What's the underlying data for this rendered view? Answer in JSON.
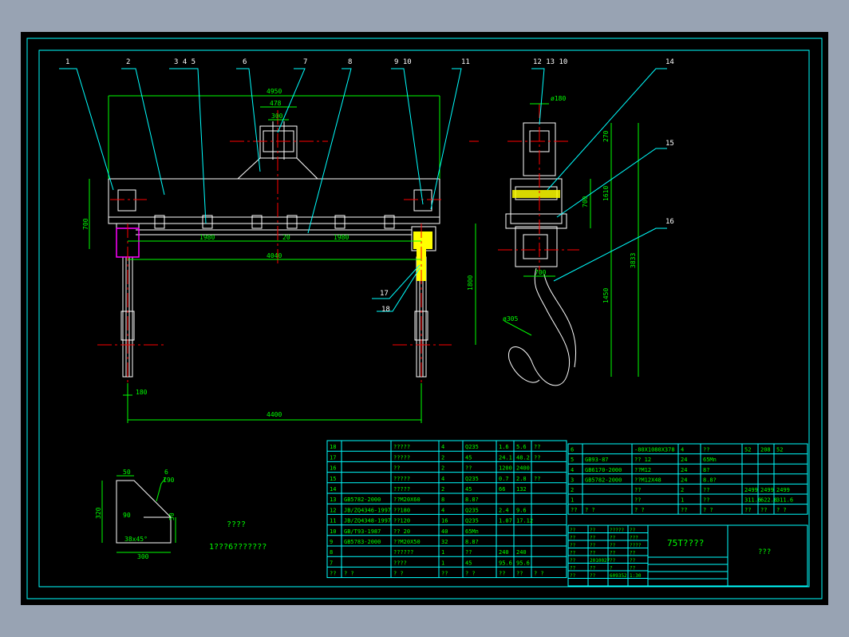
{
  "colors": {
    "background": "#000000",
    "frame": "#00ffff",
    "linework": "#ffffff",
    "dimension": "#00ff00",
    "center": "#ff0000",
    "leader": "#00ffff",
    "highlight": "#ffff00",
    "part": "#ff00ff"
  },
  "drawing": {
    "balloons": [
      "1",
      "2",
      "3",
      "4",
      "5",
      "6",
      "7",
      "8",
      "9",
      "10",
      "11",
      "12",
      "13",
      "10",
      "14",
      "15",
      "16",
      "17",
      "18"
    ],
    "balloon_345": "3 4 5",
    "balloon_910": "9 10",
    "balloon_121310": "12 13 10",
    "dims_main": {
      "d4950": "4950",
      "d478": "478",
      "d300": "300",
      "d700": "700",
      "d1980a": "1980",
      "d20": "20",
      "d1980b": "1980",
      "d4040": "4040",
      "d1800": "1800",
      "d180": "180",
      "d4400": "4400"
    },
    "dims_side": {
      "d180": "ø180",
      "d270": "270",
      "d700a": "700",
      "d1610": "1610",
      "d700b": "700",
      "d3833": "3833",
      "d1450": "1450",
      "d305": "ø305"
    },
    "detail": {
      "d50": "50",
      "d6": "6",
      "d190": "190",
      "d320": "320",
      "d90": "90",
      "d50b": "50",
      "d45": "38x45°",
      "d300": "300"
    },
    "notes": {
      "title": "????",
      "line": "1???6???????"
    }
  },
  "bom_left": {
    "rows": [
      {
        "no": "18",
        "code": "",
        "name": "?????",
        "qty": "4",
        "mat": "Q235",
        "w1": "1.6",
        "w2": "5.6",
        "note": "??"
      },
      {
        "no": "17",
        "code": "",
        "name": "?????",
        "qty": "2",
        "mat": "45",
        "w1": "24.1",
        "w2": "48.2",
        "note": "??"
      },
      {
        "no": "16",
        "code": "",
        "name": "??",
        "qty": "2",
        "mat": "??",
        "w1": "1200",
        "w2": "2400",
        "note": ""
      },
      {
        "no": "15",
        "code": "",
        "name": "?????",
        "qty": "4",
        "mat": "Q235",
        "w1": "0.7",
        "w2": "2.8",
        "note": "??"
      },
      {
        "no": "14",
        "code": "",
        "name": "?????",
        "qty": "2",
        "mat": "45",
        "w1": "66",
        "w2": "132",
        "note": ""
      },
      {
        "no": "13",
        "code": "GB5782-2000",
        "name": "??M20X60",
        "qty": "8",
        "mat": "8.8?",
        "w1": "",
        "w2": "",
        "note": ""
      },
      {
        "no": "12",
        "code": "JB/ZQ4346-1997",
        "name": "??180",
        "qty": "4",
        "mat": "Q235",
        "w1": "2.4",
        "w2": "9.6",
        "note": ""
      },
      {
        "no": "11",
        "code": "JB/ZQ4348-1997",
        "name": "??120",
        "qty": "16",
        "mat": "Q235",
        "w1": "1.07",
        "w2": "17.12",
        "note": ""
      },
      {
        "no": "10",
        "code": "GB/T93-1987",
        "name": "?? 20",
        "qty": "40",
        "mat": "65Mn",
        "w1": "",
        "w2": "",
        "note": ""
      },
      {
        "no": "9",
        "code": "GB5783-2000",
        "name": "??M20X50",
        "qty": "32",
        "mat": "8.8?",
        "w1": "",
        "w2": "",
        "note": ""
      },
      {
        "no": "8",
        "code": "",
        "name": "??????",
        "qty": "1",
        "mat": "??",
        "w1": "240",
        "w2": "240",
        "note": ""
      },
      {
        "no": "7",
        "code": "",
        "name": "????",
        "qty": "1",
        "mat": "45",
        "w1": "95.6",
        "w2": "95.6",
        "note": ""
      }
    ],
    "header": [
      "??",
      "?  ?",
      "?  ?",
      "??",
      "?  ?",
      "??",
      "??",
      "?  ?"
    ]
  },
  "bom_right": {
    "rows": [
      {
        "no": "6",
        "code": "",
        "name": "-80X1080X378",
        "qty": "4",
        "mat": "??",
        "w1": "52",
        "w2": "208"
      },
      {
        "no": "5",
        "code": "GB93-87",
        "name": "?? 12",
        "qty": "24",
        "mat": "65Mn",
        "w1": "",
        "w2": ""
      },
      {
        "no": "4",
        "code": "GB6170-2000",
        "name": "??M12",
        "qty": "24",
        "mat": "8?",
        "w1": "",
        "w2": ""
      },
      {
        "no": "3",
        "code": "GB5782-2000",
        "name": "??M12X48",
        "qty": "24",
        "mat": "8.8?",
        "w1": "",
        "w2": ""
      },
      {
        "no": "2",
        "code": "",
        "name": "??",
        "qty": "2",
        "mat": "??",
        "w1": "2499",
        "w2": "2499"
      },
      {
        "no": "1",
        "code": "",
        "name": "??",
        "qty": "1",
        "mat": "??",
        "w1": "311.6",
        "w2": "622.8"
      }
    ],
    "header": [
      "??",
      "?  ?",
      "?  ?",
      "??",
      "?  ?",
      "??",
      "??",
      "?  ?"
    ]
  },
  "title_block": {
    "title": "75T????",
    "company": "???",
    "cells": [
      "??",
      "??",
      "?????",
      "??",
      "??",
      "??",
      "??",
      "???",
      "??",
      "??",
      "??",
      "????",
      "??",
      "??",
      "??",
      "??",
      "??",
      "2010027",
      "??",
      "??",
      "??",
      "??",
      "?",
      "??",
      "??",
      "??",
      "609352",
      "1:30"
    ]
  }
}
